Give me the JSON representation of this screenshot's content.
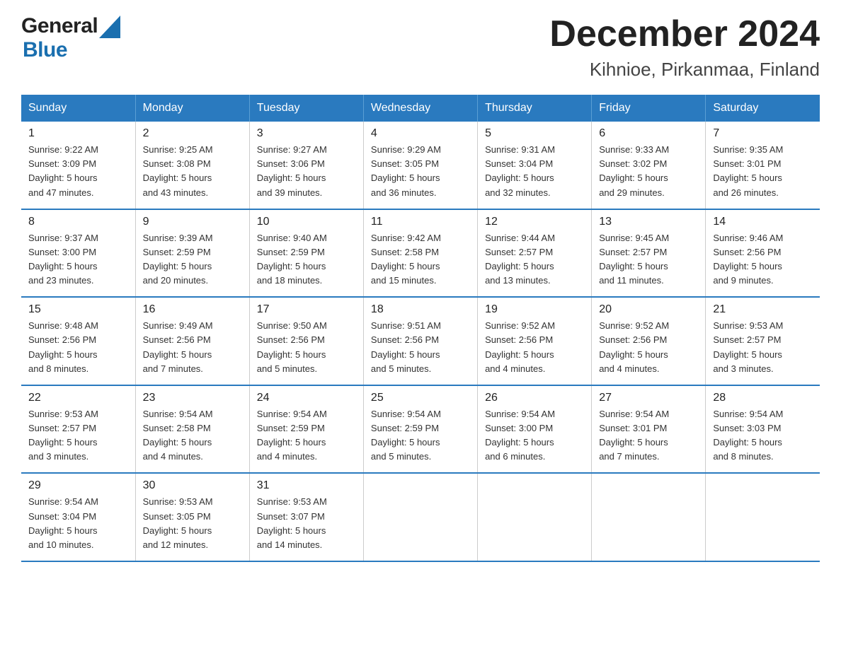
{
  "header": {
    "title": "December 2024",
    "subtitle": "Kihnioe, Pirkanmaa, Finland"
  },
  "logo": {
    "text_general": "General",
    "text_blue": "Blue"
  },
  "weekdays": [
    "Sunday",
    "Monday",
    "Tuesday",
    "Wednesday",
    "Thursday",
    "Friday",
    "Saturday"
  ],
  "weeks": [
    [
      {
        "day": "1",
        "sunrise": "9:22 AM",
        "sunset": "3:09 PM",
        "daylight": "5 hours and 47 minutes."
      },
      {
        "day": "2",
        "sunrise": "9:25 AM",
        "sunset": "3:08 PM",
        "daylight": "5 hours and 43 minutes."
      },
      {
        "day": "3",
        "sunrise": "9:27 AM",
        "sunset": "3:06 PM",
        "daylight": "5 hours and 39 minutes."
      },
      {
        "day": "4",
        "sunrise": "9:29 AM",
        "sunset": "3:05 PM",
        "daylight": "5 hours and 36 minutes."
      },
      {
        "day": "5",
        "sunrise": "9:31 AM",
        "sunset": "3:04 PM",
        "daylight": "5 hours and 32 minutes."
      },
      {
        "day": "6",
        "sunrise": "9:33 AM",
        "sunset": "3:02 PM",
        "daylight": "5 hours and 29 minutes."
      },
      {
        "day": "7",
        "sunrise": "9:35 AM",
        "sunset": "3:01 PM",
        "daylight": "5 hours and 26 minutes."
      }
    ],
    [
      {
        "day": "8",
        "sunrise": "9:37 AM",
        "sunset": "3:00 PM",
        "daylight": "5 hours and 23 minutes."
      },
      {
        "day": "9",
        "sunrise": "9:39 AM",
        "sunset": "2:59 PM",
        "daylight": "5 hours and 20 minutes."
      },
      {
        "day": "10",
        "sunrise": "9:40 AM",
        "sunset": "2:59 PM",
        "daylight": "5 hours and 18 minutes."
      },
      {
        "day": "11",
        "sunrise": "9:42 AM",
        "sunset": "2:58 PM",
        "daylight": "5 hours and 15 minutes."
      },
      {
        "day": "12",
        "sunrise": "9:44 AM",
        "sunset": "2:57 PM",
        "daylight": "5 hours and 13 minutes."
      },
      {
        "day": "13",
        "sunrise": "9:45 AM",
        "sunset": "2:57 PM",
        "daylight": "5 hours and 11 minutes."
      },
      {
        "day": "14",
        "sunrise": "9:46 AM",
        "sunset": "2:56 PM",
        "daylight": "5 hours and 9 minutes."
      }
    ],
    [
      {
        "day": "15",
        "sunrise": "9:48 AM",
        "sunset": "2:56 PM",
        "daylight": "5 hours and 8 minutes."
      },
      {
        "day": "16",
        "sunrise": "9:49 AM",
        "sunset": "2:56 PM",
        "daylight": "5 hours and 7 minutes."
      },
      {
        "day": "17",
        "sunrise": "9:50 AM",
        "sunset": "2:56 PM",
        "daylight": "5 hours and 5 minutes."
      },
      {
        "day": "18",
        "sunrise": "9:51 AM",
        "sunset": "2:56 PM",
        "daylight": "5 hours and 5 minutes."
      },
      {
        "day": "19",
        "sunrise": "9:52 AM",
        "sunset": "2:56 PM",
        "daylight": "5 hours and 4 minutes."
      },
      {
        "day": "20",
        "sunrise": "9:52 AM",
        "sunset": "2:56 PM",
        "daylight": "5 hours and 4 minutes."
      },
      {
        "day": "21",
        "sunrise": "9:53 AM",
        "sunset": "2:57 PM",
        "daylight": "5 hours and 3 minutes."
      }
    ],
    [
      {
        "day": "22",
        "sunrise": "9:53 AM",
        "sunset": "2:57 PM",
        "daylight": "5 hours and 3 minutes."
      },
      {
        "day": "23",
        "sunrise": "9:54 AM",
        "sunset": "2:58 PM",
        "daylight": "5 hours and 4 minutes."
      },
      {
        "day": "24",
        "sunrise": "9:54 AM",
        "sunset": "2:59 PM",
        "daylight": "5 hours and 4 minutes."
      },
      {
        "day": "25",
        "sunrise": "9:54 AM",
        "sunset": "2:59 PM",
        "daylight": "5 hours and 5 minutes."
      },
      {
        "day": "26",
        "sunrise": "9:54 AM",
        "sunset": "3:00 PM",
        "daylight": "5 hours and 6 minutes."
      },
      {
        "day": "27",
        "sunrise": "9:54 AM",
        "sunset": "3:01 PM",
        "daylight": "5 hours and 7 minutes."
      },
      {
        "day": "28",
        "sunrise": "9:54 AM",
        "sunset": "3:03 PM",
        "daylight": "5 hours and 8 minutes."
      }
    ],
    [
      {
        "day": "29",
        "sunrise": "9:54 AM",
        "sunset": "3:04 PM",
        "daylight": "5 hours and 10 minutes."
      },
      {
        "day": "30",
        "sunrise": "9:53 AM",
        "sunset": "3:05 PM",
        "daylight": "5 hours and 12 minutes."
      },
      {
        "day": "31",
        "sunrise": "9:53 AM",
        "sunset": "3:07 PM",
        "daylight": "5 hours and 14 minutes."
      },
      null,
      null,
      null,
      null
    ]
  ],
  "labels": {
    "sunrise": "Sunrise:",
    "sunset": "Sunset:",
    "daylight": "Daylight:"
  }
}
